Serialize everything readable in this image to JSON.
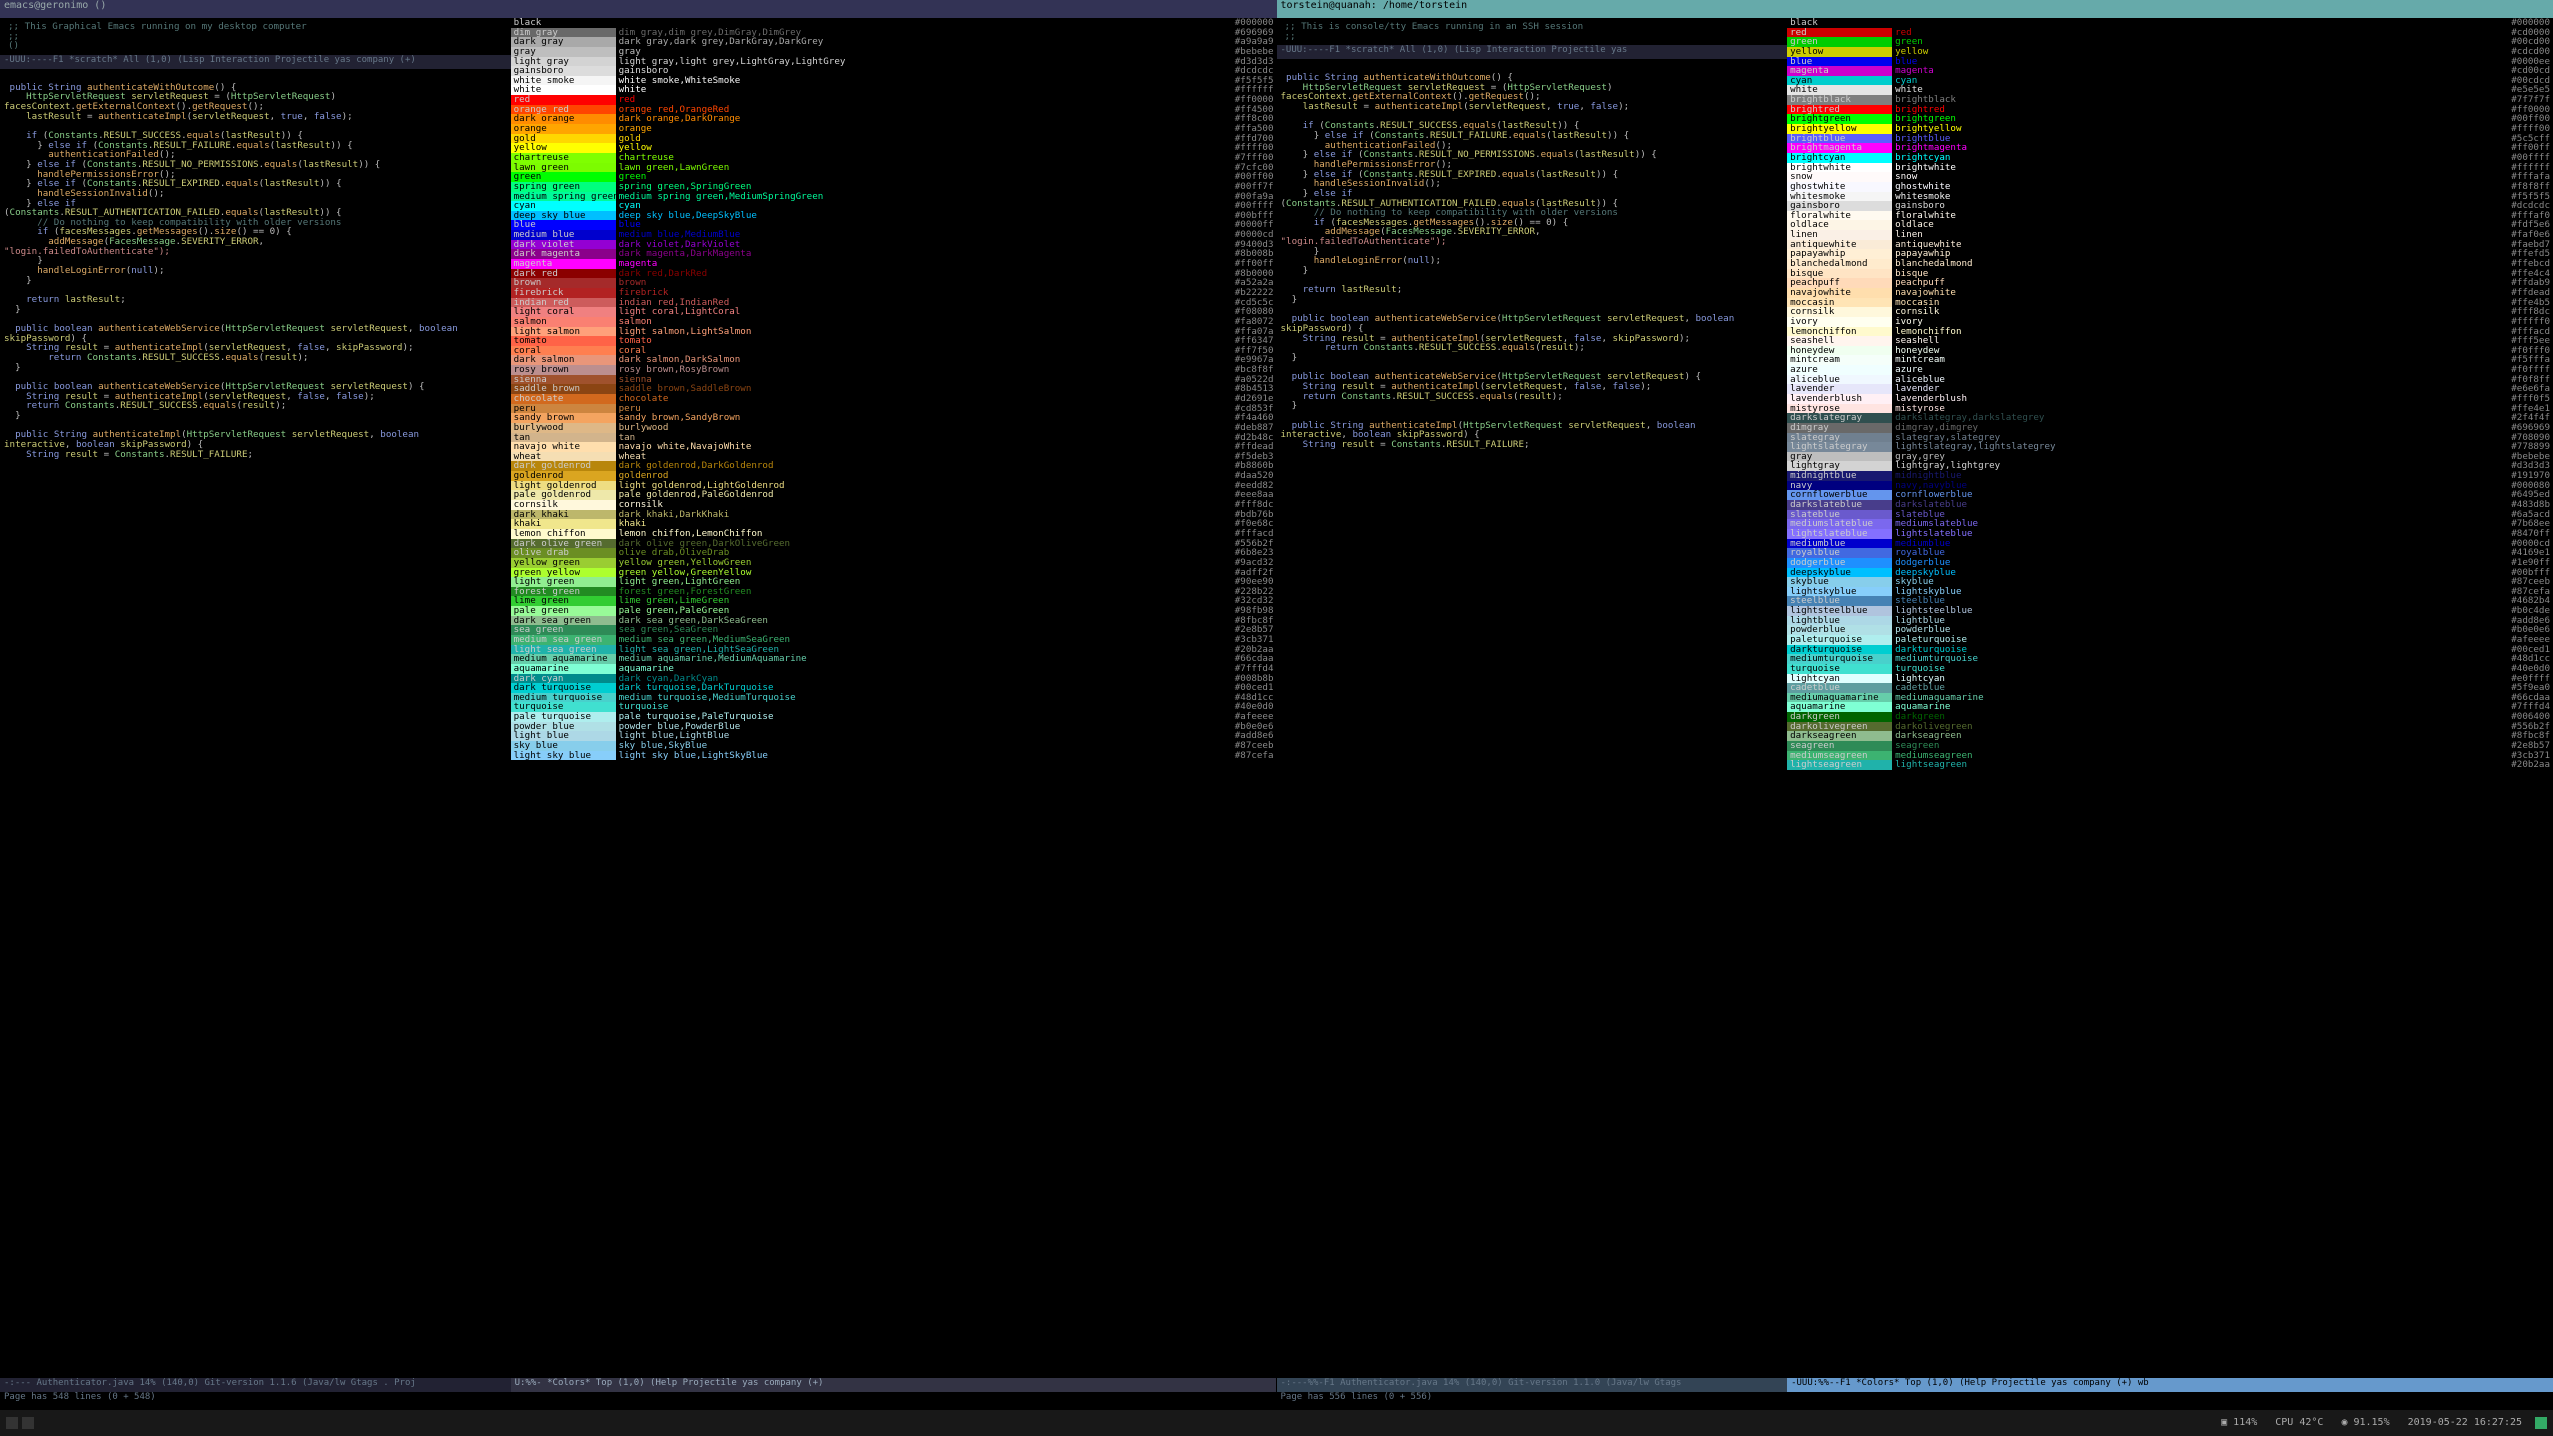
{
  "taskbar": {
    "items": [
      "▣ 114%",
      "CPU 42°C",
      "◉ 91.15%",
      "2019-05-22  16:27:25"
    ]
  },
  "left": {
    "title": "emacs@geronimo ()",
    "comment": ";; This Graphical Emacs running on my desktop computer\n;;\n()",
    "echo": "Page has 548 lines (0 + 548)",
    "modeline_scratch": "-UUU:----F1  *scratch*   All (1,0)     (Lisp Interaction Projectile yas company (+)",
    "modeline_code": "-:--- Authenticator.java   14% (140,0)  Git-version 1.1.6  (Java/lw Gtags . Proj",
    "modeline_colors": "U:%%-  *Colors*        Top (1,0)        (Help Projectile yas company (+)",
    "colors": [
      [
        "black",
        "black",
        "#000000"
      ],
      [
        "dim gray",
        "dim gray,dim grey,DimGray,DimGrey",
        "#696969"
      ],
      [
        "dark gray",
        "dark gray,dark grey,DarkGray,DarkGrey",
        "#a9a9a9"
      ],
      [
        "gray",
        "gray",
        "#bebebe"
      ],
      [
        "light gray",
        "light gray,light grey,LightGray,LightGrey",
        "#d3d3d3"
      ],
      [
        "gainsboro",
        "gainsboro",
        "#dcdcdc"
      ],
      [
        "white smoke",
        "white smoke,WhiteSmoke",
        "#f5f5f5"
      ],
      [
        "white",
        "white",
        "#ffffff"
      ],
      [
        "red",
        "red",
        "#ff0000"
      ],
      [
        "orange red",
        "orange red,OrangeRed",
        "#ff4500"
      ],
      [
        "dark orange",
        "dark orange,DarkOrange",
        "#ff8c00"
      ],
      [
        "orange",
        "orange",
        "#ffa500"
      ],
      [
        "gold",
        "gold",
        "#ffd700"
      ],
      [
        "yellow",
        "yellow",
        "#ffff00"
      ],
      [
        "chartreuse",
        "chartreuse",
        "#7fff00"
      ],
      [
        "lawn green",
        "lawn green,LawnGreen",
        "#7cfc00"
      ],
      [
        "green",
        "green",
        "#00ff00"
      ],
      [
        "spring green",
        "spring green,SpringGreen",
        "#00ff7f"
      ],
      [
        "medium spring green",
        "medium spring green,MediumSpringGreen",
        "#00fa9a"
      ],
      [
        "cyan",
        "cyan",
        "#00ffff"
      ],
      [
        "deep sky blue",
        "deep sky blue,DeepSkyBlue",
        "#00bfff"
      ],
      [
        "blue",
        "blue",
        "#0000ff"
      ],
      [
        "medium blue",
        "medium blue,MediumBlue",
        "#0000cd"
      ],
      [
        "dark violet",
        "dark violet,DarkViolet",
        "#9400d3"
      ],
      [
        "dark magenta",
        "dark magenta,DarkMagenta",
        "#8b008b"
      ],
      [
        "magenta",
        "magenta",
        "#ff00ff"
      ],
      [
        "dark red",
        "dark red,DarkRed",
        "#8b0000"
      ],
      [
        "brown",
        "brown",
        "#a52a2a"
      ],
      [
        "firebrick",
        "firebrick",
        "#b22222"
      ],
      [
        "indian red",
        "indian red,IndianRed",
        "#cd5c5c"
      ],
      [
        "light coral",
        "light coral,LightCoral",
        "#f08080"
      ],
      [
        "salmon",
        "salmon",
        "#fa8072"
      ],
      [
        "light salmon",
        "light salmon,LightSalmon",
        "#ffa07a"
      ],
      [
        "tomato",
        "tomato",
        "#ff6347"
      ],
      [
        "coral",
        "coral",
        "#ff7f50"
      ],
      [
        "dark salmon",
        "dark salmon,DarkSalmon",
        "#e9967a"
      ],
      [
        "rosy brown",
        "rosy brown,RosyBrown",
        "#bc8f8f"
      ],
      [
        "sienna",
        "sienna",
        "#a0522d"
      ],
      [
        "saddle brown",
        "saddle brown,SaddleBrown",
        "#8b4513"
      ],
      [
        "chocolate",
        "chocolate",
        "#d2691e"
      ],
      [
        "peru",
        "peru",
        "#cd853f"
      ],
      [
        "sandy brown",
        "sandy brown,SandyBrown",
        "#f4a460"
      ],
      [
        "burlywood",
        "burlywood",
        "#deb887"
      ],
      [
        "tan",
        "tan",
        "#d2b48c"
      ],
      [
        "navajo white",
        "navajo white,NavajoWhite",
        "#ffdead"
      ],
      [
        "wheat",
        "wheat",
        "#f5deb3"
      ],
      [
        "dark goldenrod",
        "dark goldenrod,DarkGoldenrod",
        "#b8860b"
      ],
      [
        "goldenrod",
        "goldenrod",
        "#daa520"
      ],
      [
        "light goldenrod",
        "light goldenrod,LightGoldenrod",
        "#eedd82"
      ],
      [
        "pale goldenrod",
        "pale goldenrod,PaleGoldenrod",
        "#eee8aa"
      ],
      [
        "cornsilk",
        "cornsilk",
        "#fff8dc"
      ],
      [
        "dark khaki",
        "dark khaki,DarkKhaki",
        "#bdb76b"
      ],
      [
        "khaki",
        "khaki",
        "#f0e68c"
      ],
      [
        "lemon chiffon",
        "lemon chiffon,LemonChiffon",
        "#fffacd"
      ],
      [
        "dark olive green",
        "dark olive green,DarkOliveGreen",
        "#556b2f"
      ],
      [
        "olive drab",
        "olive drab,OliveDrab",
        "#6b8e23"
      ],
      [
        "yellow green",
        "yellow green,YellowGreen",
        "#9acd32"
      ],
      [
        "green yellow",
        "green yellow,GreenYellow",
        "#adff2f"
      ],
      [
        "light green",
        "light green,LightGreen",
        "#90ee90"
      ],
      [
        "forest green",
        "forest green,ForestGreen",
        "#228b22"
      ],
      [
        "lime green",
        "lime green,LimeGreen",
        "#32cd32"
      ],
      [
        "pale green",
        "pale green,PaleGreen",
        "#98fb98"
      ],
      [
        "dark sea green",
        "dark sea green,DarkSeaGreen",
        "#8fbc8f"
      ],
      [
        "sea green",
        "sea green,SeaGreen",
        "#2e8b57"
      ],
      [
        "medium sea green",
        "medium sea green,MediumSeaGreen",
        "#3cb371"
      ],
      [
        "light sea green",
        "light sea green,LightSeaGreen",
        "#20b2aa"
      ],
      [
        "medium aquamarine",
        "medium aquamarine,MediumAquamarine",
        "#66cdaa"
      ],
      [
        "aquamarine",
        "aquamarine",
        "#7fffd4"
      ],
      [
        "dark cyan",
        "dark cyan,DarkCyan",
        "#008b8b"
      ],
      [
        "dark turquoise",
        "dark turquoise,DarkTurquoise",
        "#00ced1"
      ],
      [
        "medium turquoise",
        "medium turquoise,MediumTurquoise",
        "#48d1cc"
      ],
      [
        "turquoise",
        "turquoise",
        "#40e0d0"
      ],
      [
        "pale turquoise",
        "pale turquoise,PaleTurquoise",
        "#afeeee"
      ],
      [
        "powder blue",
        "powder blue,PowderBlue",
        "#b0e0e6"
      ],
      [
        "light blue",
        "light blue,LightBlue",
        "#add8e6"
      ],
      [
        "sky blue",
        "sky blue,SkyBlue",
        "#87ceeb"
      ],
      [
        "light sky blue",
        "light sky blue,LightSkyBlue",
        "#87cefa"
      ]
    ]
  },
  "right": {
    "title": "torstein@quanah: /home/torstein",
    "comment": ";; This is console/tty Emacs running in an SSH session\n;;",
    "echo": "Page has 556 lines (0 + 556)",
    "modeline_scratch": "-UUU:----F1  *scratch*      All (1,0)     (Lisp Interaction Projectile yas",
    "modeline_code": " -:---%%-F1  Authenticator.java   14% (140,0)  Git-version 1.1.0  (Java/lw Gtags",
    "modeline_colors": "-UUU:%%--F1  *Colors*         Top (1,0)      (Help Projectile yas company (+) wb",
    "colors": [
      [
        "black",
        "black",
        "#000000"
      ],
      [
        "red",
        "red",
        "#cd0000"
      ],
      [
        "green",
        "green",
        "#00cd00"
      ],
      [
        "yellow",
        "yellow",
        "#cdcd00"
      ],
      [
        "blue",
        "blue",
        "#0000ee"
      ],
      [
        "magenta",
        "magenta",
        "#cd00cd"
      ],
      [
        "cyan",
        "cyan",
        "#00cdcd"
      ],
      [
        "white",
        "white",
        "#e5e5e5"
      ],
      [
        "brightblack",
        "brightblack",
        "#7f7f7f"
      ],
      [
        "brightred",
        "brightred",
        "#ff0000"
      ],
      [
        "brightgreen",
        "brightgreen",
        "#00ff00"
      ],
      [
        "brightyellow",
        "brightyellow",
        "#ffff00"
      ],
      [
        "brightblue",
        "brightblue",
        "#5c5cff"
      ],
      [
        "brightmagenta",
        "brightmagenta",
        "#ff00ff"
      ],
      [
        "brightcyan",
        "brightcyan",
        "#00ffff"
      ],
      [
        "brightwhite",
        "brightwhite",
        "#ffffff"
      ],
      [
        "snow",
        "snow",
        "#fffafa"
      ],
      [
        "ghostwhite",
        "ghostwhite",
        "#f8f8ff"
      ],
      [
        "whitesmoke",
        "whitesmoke",
        "#f5f5f5"
      ],
      [
        "gainsboro",
        "gainsboro",
        "#dcdcdc"
      ],
      [
        "floralwhite",
        "floralwhite",
        "#fffaf0"
      ],
      [
        "oldlace",
        "oldlace",
        "#fdf5e6"
      ],
      [
        "linen",
        "linen",
        "#faf0e6"
      ],
      [
        "antiquewhite",
        "antiquewhite",
        "#faebd7"
      ],
      [
        "papayawhip",
        "papayawhip",
        "#ffefd5"
      ],
      [
        "blanchedalmond",
        "blanchedalmond",
        "#ffebcd"
      ],
      [
        "bisque",
        "bisque",
        "#ffe4c4"
      ],
      [
        "peachpuff",
        "peachpuff",
        "#ffdab9"
      ],
      [
        "navajowhite",
        "navajowhite",
        "#ffdead"
      ],
      [
        "moccasin",
        "moccasin",
        "#ffe4b5"
      ],
      [
        "cornsilk",
        "cornsilk",
        "#fff8dc"
      ],
      [
        "ivory",
        "ivory",
        "#fffff0"
      ],
      [
        "lemonchiffon",
        "lemonchiffon",
        "#fffacd"
      ],
      [
        "seashell",
        "seashell",
        "#fff5ee"
      ],
      [
        "honeydew",
        "honeydew",
        "#f0fff0"
      ],
      [
        "mintcream",
        "mintcream",
        "#f5fffa"
      ],
      [
        "azure",
        "azure",
        "#f0ffff"
      ],
      [
        "aliceblue",
        "aliceblue",
        "#f0f8ff"
      ],
      [
        "lavender",
        "lavender",
        "#e6e6fa"
      ],
      [
        "lavenderblush",
        "lavenderblush",
        "#fff0f5"
      ],
      [
        "mistyrose",
        "mistyrose",
        "#ffe4e1"
      ],
      [
        "darkslategray",
        "darkslategray,darkslategrey",
        "#2f4f4f"
      ],
      [
        "dimgray",
        "dimgray,dimgrey",
        "#696969"
      ],
      [
        "slategray",
        "slategray,slategrey",
        "#708090"
      ],
      [
        "lightslategray",
        "lightslategray,lightslategrey",
        "#778899"
      ],
      [
        "gray",
        "gray,grey",
        "#bebebe"
      ],
      [
        "lightgray",
        "lightgray,lightgrey",
        "#d3d3d3"
      ],
      [
        "midnightblue",
        "midnightblue",
        "#191970"
      ],
      [
        "navy",
        "navy,navyblue",
        "#000080"
      ],
      [
        "cornflowerblue",
        "cornflowerblue",
        "#6495ed"
      ],
      [
        "darkslateblue",
        "darkslateblue",
        "#483d8b"
      ],
      [
        "slateblue",
        "slateblue",
        "#6a5acd"
      ],
      [
        "mediumslateblue",
        "mediumslateblue",
        "#7b68ee"
      ],
      [
        "lightslateblue",
        "lightslateblue",
        "#8470ff"
      ],
      [
        "mediumblue",
        "mediumblue",
        "#0000cd"
      ],
      [
        "royalblue",
        "royalblue",
        "#4169e1"
      ],
      [
        "dodgerblue",
        "dodgerblue",
        "#1e90ff"
      ],
      [
        "deepskyblue",
        "deepskyblue",
        "#00bfff"
      ],
      [
        "skyblue",
        "skyblue",
        "#87ceeb"
      ],
      [
        "lightskyblue",
        "lightskyblue",
        "#87cefa"
      ],
      [
        "steelblue",
        "steelblue",
        "#4682b4"
      ],
      [
        "lightsteelblue",
        "lightsteelblue",
        "#b0c4de"
      ],
      [
        "lightblue",
        "lightblue",
        "#add8e6"
      ],
      [
        "powderblue",
        "powderblue",
        "#b0e0e6"
      ],
      [
        "paleturquoise",
        "paleturquoise",
        "#afeeee"
      ],
      [
        "darkturquoise",
        "darkturquoise",
        "#00ced1"
      ],
      [
        "mediumturquoise",
        "mediumturquoise",
        "#48d1cc"
      ],
      [
        "turquoise",
        "turquoise",
        "#40e0d0"
      ],
      [
        "lightcyan",
        "lightcyan",
        "#e0ffff"
      ],
      [
        "cadetblue",
        "cadetblue",
        "#5f9ea0"
      ],
      [
        "mediumaquamarine",
        "mediumaquamarine",
        "#66cdaa"
      ],
      [
        "aquamarine",
        "aquamarine",
        "#7fffd4"
      ],
      [
        "darkgreen",
        "darkgreen",
        "#006400"
      ],
      [
        "darkolivegreen",
        "darkolivegreen",
        "#556b2f"
      ],
      [
        "darkseagreen",
        "darkseagreen",
        "#8fbc8f"
      ],
      [
        "seagreen",
        "seagreen",
        "#2e8b57"
      ],
      [
        "mediumseagreen",
        "mediumseagreen",
        "#3cb371"
      ],
      [
        "lightseagreen",
        "lightseagreen",
        "#20b2aa"
      ]
    ]
  },
  "code": [
    {
      "raw": "",
      "cls": ""
    },
    {
      "raw": " public String authenticateWithOutcome() {",
      "cls": ""
    },
    {
      "raw": "    HttpServletRequest servletRequest = (HttpServletRequest)",
      "cls": ""
    },
    {
      "raw": "facesContext.getExternalContext().getRequest();",
      "cls": ""
    },
    {
      "raw": "    lastResult = authenticateImpl(servletRequest, true, false);",
      "cls": ""
    },
    {
      "raw": "",
      "cls": ""
    },
    {
      "raw": "    if (Constants.RESULT_SUCCESS.equals(lastResult)) {",
      "cls": ""
    },
    {
      "raw": "      } else if (Constants.RESULT_FAILURE.equals(lastResult)) {",
      "cls": ""
    },
    {
      "raw": "        authenticationFailed();",
      "cls": ""
    },
    {
      "raw": "    } else if (Constants.RESULT_NO_PERMISSIONS.equals(lastResult)) {",
      "cls": ""
    },
    {
      "raw": "      handlePermissionsError();",
      "cls": ""
    },
    {
      "raw": "    } else if (Constants.RESULT_EXPIRED.equals(lastResult)) {",
      "cls": ""
    },
    {
      "raw": "      handleSessionInvalid();",
      "cls": ""
    },
    {
      "raw": "    } else if",
      "cls": ""
    },
    {
      "raw": "(Constants.RESULT_AUTHENTICATION_FAILED.equals(lastResult)) {",
      "cls": ""
    },
    {
      "raw": "      // Do nothing to keep compatibility with older versions",
      "cls": "cmt"
    },
    {
      "raw": "      if (facesMessages.getMessages().size() == 0) {",
      "cls": ""
    },
    {
      "raw": "        addMessage(FacesMessage.SEVERITY_ERROR,",
      "cls": ""
    },
    {
      "raw": "\"login.failedToAuthenticate\");",
      "cls": "str"
    },
    {
      "raw": "      }",
      "cls": ""
    },
    {
      "raw": "      handleLoginError(null);",
      "cls": ""
    },
    {
      "raw": "    }",
      "cls": ""
    },
    {
      "raw": "",
      "cls": ""
    },
    {
      "raw": "    return lastResult;",
      "cls": ""
    },
    {
      "raw": "  }",
      "cls": ""
    },
    {
      "raw": "",
      "cls": ""
    },
    {
      "raw": "  public boolean authenticateWebService(HttpServletRequest servletRequest, boolean",
      "cls": ""
    },
    {
      "raw": "skipPassword) {",
      "cls": ""
    },
    {
      "raw": "    String result = authenticateImpl(servletRequest, false, skipPassword);",
      "cls": ""
    },
    {
      "raw": "        return Constants.RESULT_SUCCESS.equals(result);",
      "cls": ""
    },
    {
      "raw": "  }",
      "cls": ""
    },
    {
      "raw": "",
      "cls": ""
    },
    {
      "raw": "  public boolean authenticateWebService(HttpServletRequest servletRequest) {",
      "cls": ""
    },
    {
      "raw": "    String result = authenticateImpl(servletRequest, false, false);",
      "cls": ""
    },
    {
      "raw": "    return Constants.RESULT_SUCCESS.equals(result);",
      "cls": ""
    },
    {
      "raw": "  }",
      "cls": ""
    },
    {
      "raw": "",
      "cls": ""
    },
    {
      "raw": "  public String authenticateImpl(HttpServletRequest servletRequest, boolean",
      "cls": ""
    },
    {
      "raw": "interactive, boolean skipPassword) {",
      "cls": ""
    },
    {
      "raw": "    String result = Constants.RESULT_FAILURE;",
      "cls": ""
    }
  ]
}
